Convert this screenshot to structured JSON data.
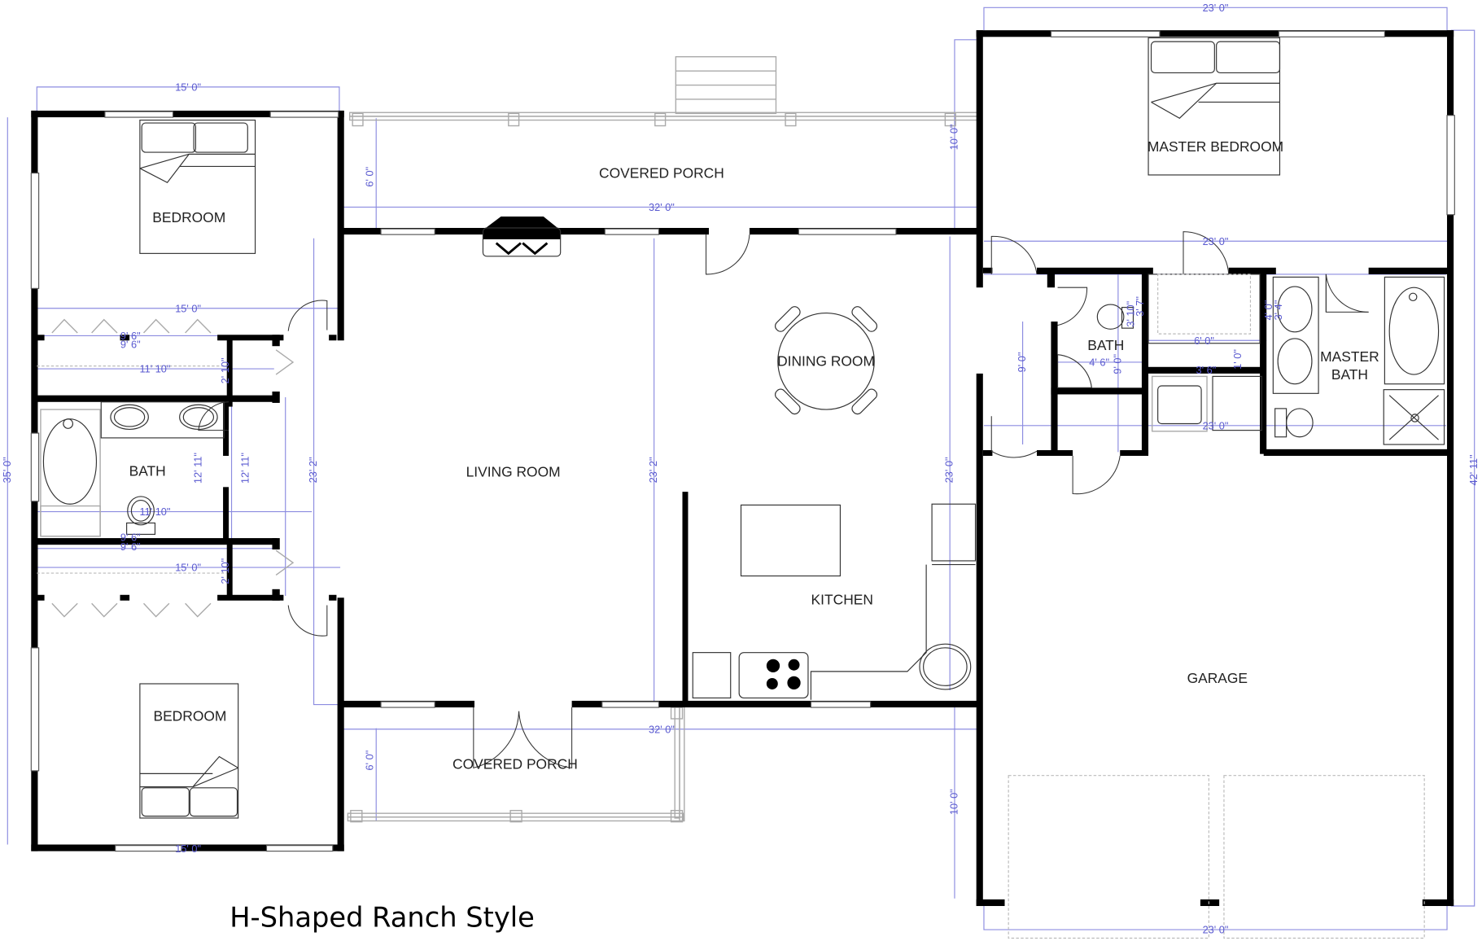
{
  "title": "H-Shaped Ranch Style",
  "colors": {
    "wall": "#000000",
    "dimension": "#5a5ad0",
    "dimension_line": "#8c8ce0",
    "fixture": "#333333",
    "background": "#ffffff"
  },
  "rooms": {
    "bedroom_top": "BEDROOM",
    "bedroom_bottom": "BEDROOM",
    "bath_left": "BATH",
    "covered_porch_top": "COVERED PORCH",
    "covered_porch_bottom": "COVERED PORCH",
    "living_room": "LIVING ROOM",
    "dining_room": "DINING ROOM",
    "kitchen": "KITCHEN",
    "master_bedroom": "MASTER BEDROOM",
    "bath_right": "BATH",
    "master_bath_line1": "MASTER",
    "master_bath_line2": "BATH",
    "garage": "GARAGE"
  },
  "dimensions": {
    "bedroom_top_width": "15' 0\"",
    "closet_top_width": "15' 0\"",
    "closet_top_sub1": "9' 6\"",
    "closet_top_sub2": "9' 6\"",
    "hall_top_width": "11' 10\"",
    "linen_top_depth": "2' 10\"",
    "bath_left_height_a": "12' 11\"",
    "bath_left_height_b": "12' 11\"",
    "bath_left_width": "11' 10\"",
    "closet_bottom_sub1": "9' 6\"",
    "closet_bottom_sub2": "9' 6\"",
    "closet_bottom_width": "15' 0\"",
    "linen_bottom_depth": "2' 10\"",
    "bedroom_bottom_width": "15' 0\"",
    "overall_left_height": "35' 0\"",
    "porch_top_depth": "6' 0\"",
    "porch_top_width": "32' 0\"",
    "living_height_left": "23' 2\"",
    "living_height_right": "23' 2\"",
    "porch_bottom_width": "32' 0\"",
    "porch_bottom_depth": "6' 0\"",
    "master_bedroom_width": "23' 0\"",
    "master_bedroom_depth": "10' 0\"",
    "master_suite_width": "23' 0\"",
    "hall_right_height": "9' 0\"",
    "bath_right_width": "4' 6\"",
    "bath_right_height": "9' 0\"",
    "closet_right_a": "3' 10\"",
    "closet_right_b": "3' 7\"",
    "walkin_width": "6' 0\"",
    "laundry_width": "3' 6\"",
    "laundry_depth": "1' 0\"",
    "master_bath_a": "4' 0\"",
    "master_bath_b": "3' 4\"",
    "wing_right_width": "23' 0\"",
    "kitchen_height": "23' 0\"",
    "garage_depth": "10' 0\"",
    "garage_width": "23' 0\"",
    "overall_right_height": "42' 11\""
  }
}
